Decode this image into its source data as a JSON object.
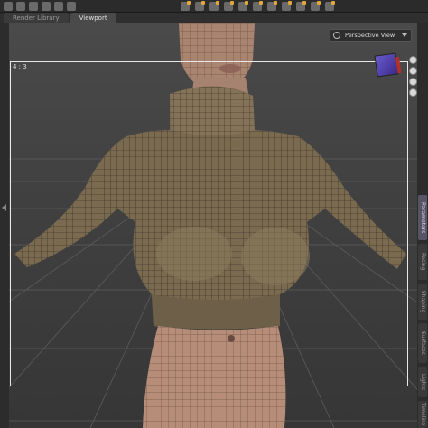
{
  "tabs": [
    {
      "label": "Render Library",
      "active": false
    },
    {
      "label": "Viewport",
      "active": true
    }
  ],
  "viewport": {
    "camera_label": "Perspective View",
    "aspect_ratio": "4 : 3"
  },
  "toolbar": {
    "left_icons": [
      "select-icon",
      "rotate-icon",
      "translate-icon",
      "scale-icon",
      "universal-icon",
      "region-icon"
    ],
    "right_icons": [
      "render-icon",
      "spot-render-icon",
      "iray-icon",
      "camera-icon",
      "light-icon",
      "node-icon",
      "bone-icon",
      "morph-icon",
      "geometry-icon",
      "shape-icon",
      "surface-icon"
    ]
  },
  "right_panel_tabs": [
    "Parameters",
    "Posing",
    "Shaping",
    "Surfaces",
    "Lights",
    "Timeline"
  ],
  "colors": {
    "background": "#3a3a3a",
    "sweater": "#7a6a50",
    "skin": "#b08a74",
    "wire": "#1a1a1a",
    "accent": "#e0a83a"
  }
}
